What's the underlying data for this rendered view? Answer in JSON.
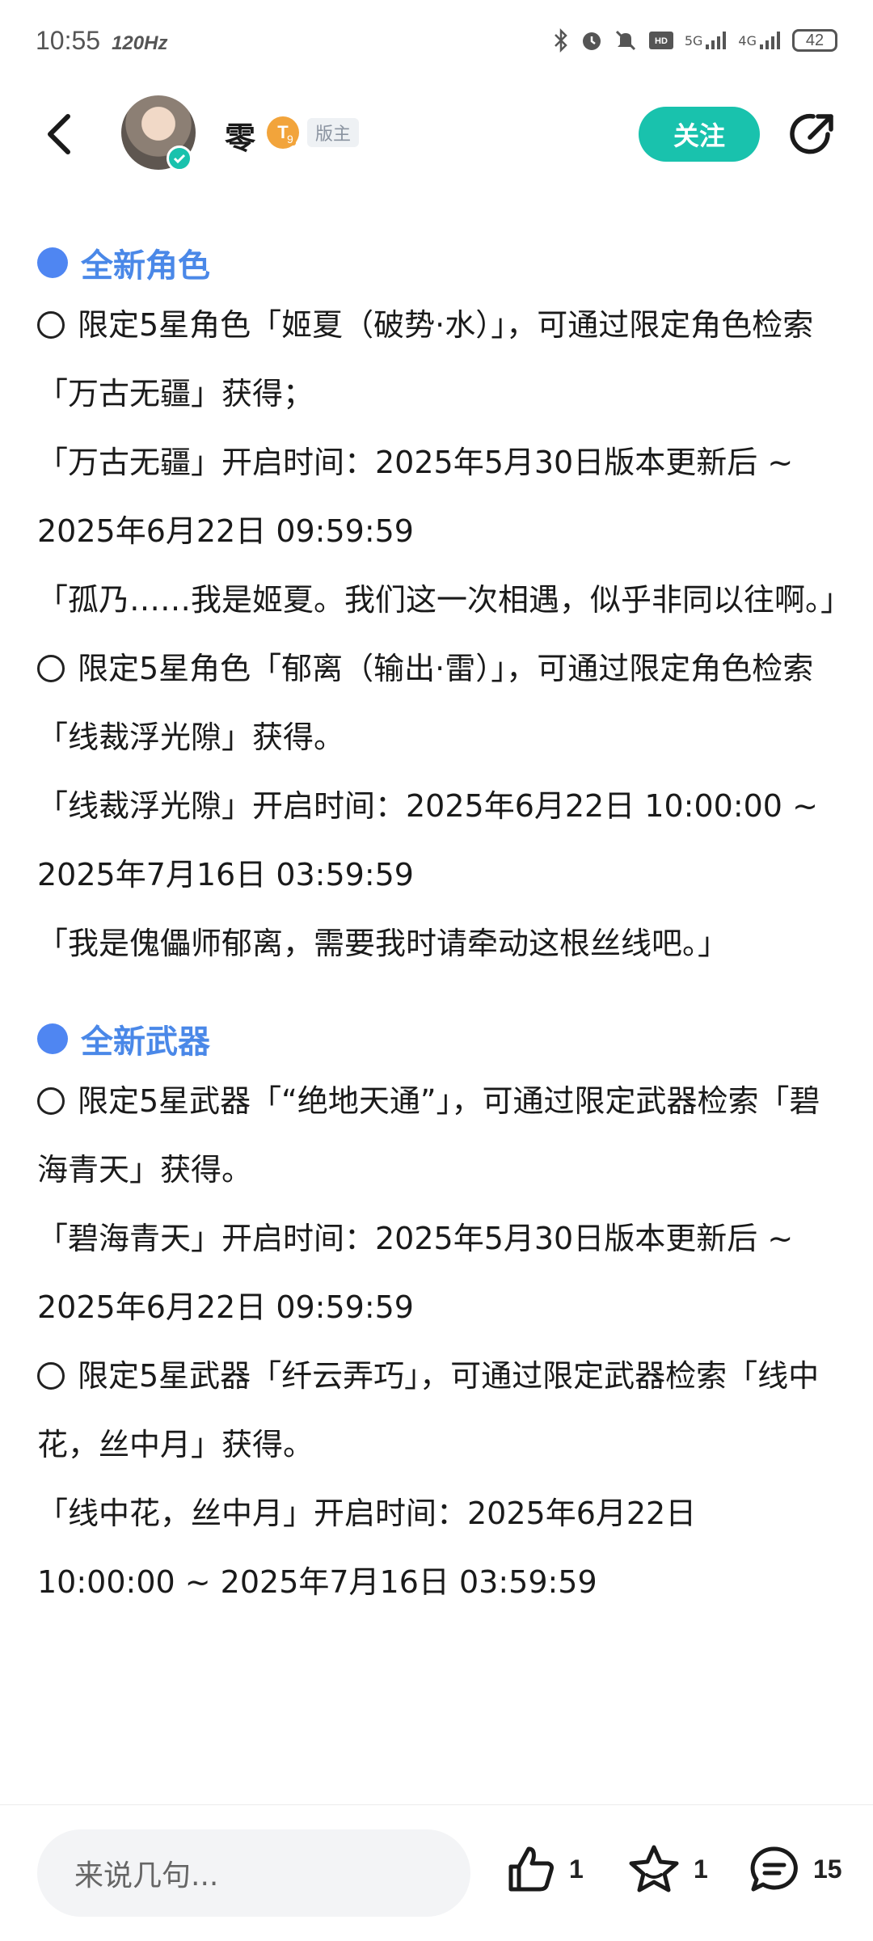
{
  "status": {
    "time": "10:55",
    "refresh": "120Hz",
    "network_a": "5G",
    "network_b": "4G",
    "battery": "42"
  },
  "header": {
    "username": "零",
    "level_letter": "T",
    "level_num": "9",
    "role_tag": "版主",
    "follow_label": "关注"
  },
  "content": {
    "sections": [
      {
        "title": "全新角色",
        "paragraphs": [
          "限定5星角色「姬夏（破势·水）」，可通过限定角色检索「万古无疆」获得；",
          "「万古无疆」开启时间：2025年5月30日版本更新后 ~ 2025年6月22日 09:59:59",
          "「孤乃……我是姬夏。我们这一次相遇，似乎非同以往啊。」",
          "限定5星角色「郁离（输出·雷）」，可通过限定角色检索「线裁浮光隙」获得。",
          "「线裁浮光隙」开启时间：2025年6月22日 10:00:00 ~ 2025年7月16日 03:59:59",
          "「我是傀儡师郁离，需要我时请牵动这根丝线吧。」"
        ]
      },
      {
        "title": "全新武器",
        "paragraphs": [
          "限定5星武器「“绝地天通”」，可通过限定武器检索「碧海青天」获得。",
          "「碧海青天」开启时间：2025年5月30日版本更新后 ~ 2025年6月22日 09:59:59",
          "限定5星武器「纤云弄巧」，可通过限定武器检索「线中花，丝中月」获得。",
          "「线中花，丝中月」开启时间：2025年6月22日 10:00:00 ~ 2025年7月16日 03:59:59"
        ]
      }
    ]
  },
  "bottom": {
    "comment_placeholder": "来说几句...",
    "like_count": "1",
    "star_count": "1",
    "comment_count": "15"
  },
  "colors": {
    "accent": "#19c2ad",
    "section_title": "#4a88e8"
  }
}
